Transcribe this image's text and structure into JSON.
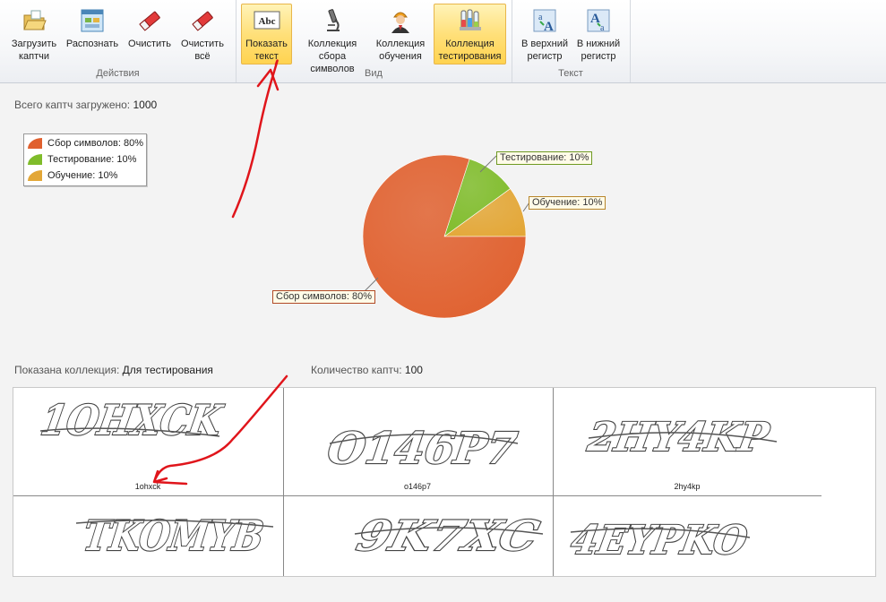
{
  "ribbon": {
    "groups": [
      {
        "label": "Действия"
      },
      {
        "label": "Вид"
      },
      {
        "label": "Текст"
      }
    ],
    "buttons": [
      {
        "label": "Загрузить\nкаптчи",
        "icon": "folder-open-icon"
      },
      {
        "label": "Распознать",
        "icon": "recognize-icon"
      },
      {
        "label": "Очистить",
        "icon": "eraser-icon"
      },
      {
        "label": "Очистить\nвсё",
        "icon": "eraser-all-icon"
      },
      {
        "label": "Показать\nтекст",
        "icon": "abc-text-icon",
        "icon_text": "Abc",
        "active": true
      },
      {
        "label": "Коллекция\nсбора символов",
        "icon": "microscope-icon"
      },
      {
        "label": "Коллекция\nобучения",
        "icon": "worker-icon"
      },
      {
        "label": "Коллекция\nтестирования",
        "icon": "test-tubes-icon",
        "active": true
      },
      {
        "label": "В верхний\nрегистр",
        "icon": "uppercase-icon"
      },
      {
        "label": "В нижний\nрегистр",
        "icon": "lowercase-icon"
      }
    ]
  },
  "summary": {
    "total_label": "Всего каптч загружено:",
    "total_value": "1000",
    "collection_label": "Показана коллекция:",
    "collection_value": "Для тестирования",
    "count_label": "Количество каптч:",
    "count_value": "100"
  },
  "chart_data": {
    "type": "pie",
    "categories": [
      "Сбор символов",
      "Тестирование",
      "Обучение"
    ],
    "values": [
      80,
      10,
      10
    ],
    "colors": [
      "#e0602e",
      "#7fbc2a",
      "#e3a737"
    ],
    "legend": [
      "Сбор символов: 80%",
      "Тестирование: 10%",
      "Обучение: 10%"
    ],
    "labels": [
      "Сбор символов: 80%",
      "Тестирование: 10%",
      "Обучение: 10%"
    ],
    "legend_position": "top-left"
  },
  "captchas": [
    {
      "image_text": "1OHXCK",
      "caption": "1ohxck"
    },
    {
      "image_text": "O146P7",
      "caption": "o146p7"
    },
    {
      "image_text": "2HY4KP",
      "caption": "2hy4kp"
    },
    {
      "image_text": "TKOMYB",
      "caption": ""
    },
    {
      "image_text": "9K7XC",
      "caption": ""
    },
    {
      "image_text": "4EYPKO",
      "caption": ""
    }
  ],
  "annotation_color": "#e0151b"
}
